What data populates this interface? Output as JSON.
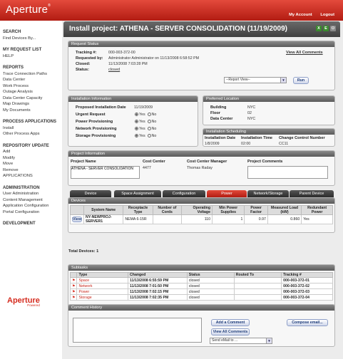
{
  "header": {
    "logo": "Aperture",
    "logo_mark": "®",
    "my_account": "My Account",
    "logout": "Logout"
  },
  "sidebar": {
    "groups": [
      {
        "heading": "SEARCH",
        "items": [
          "Find Devices By..."
        ]
      },
      {
        "heading": "MY REQUEST LIST",
        "items": [
          "HELP"
        ]
      },
      {
        "heading": "REPORTS",
        "items": [
          "Trace Connection Paths",
          "Data Center",
          "Work Process",
          "Outage Analysis",
          "Data Center Capacity",
          "Map Drawings",
          "My Documents"
        ]
      },
      {
        "heading": "PROCESS APPLICATIONS",
        "items": [
          "Install",
          "Other Process Apps"
        ]
      },
      {
        "heading": "REPOSITORY UPDATE",
        "items": [
          "Add",
          "Modify",
          "Move",
          "Remove",
          "APPLICATIONS"
        ]
      },
      {
        "heading": "ADMINISTRATION",
        "items": [
          "User Administration",
          "Content Management",
          "Application Configuration",
          "Portal Configuration"
        ]
      },
      {
        "heading": "DEVELOPMENT",
        "items": []
      }
    ],
    "bottom_logo": "Aperture",
    "bottom_logo_sub": "Powered"
  },
  "page": {
    "title": "Install project: ATHENA - SERVER CONSOLIDATION (11/19/2009)"
  },
  "request_status": {
    "heading": "Request Status",
    "tracking_label": "Tracking #:",
    "tracking": "000-003-372-00",
    "requested_label": "Requested by:",
    "requested": "Administrator Administrator on 11/13/2008 6:58:52 PM",
    "closed_label": "Closed:",
    "closed": "11/13/2008 7:03:28 PM",
    "status_label": "Status:",
    "status": "closed",
    "view_all": "View All Comments",
    "report_view": "--Report View--",
    "run": "Run"
  },
  "installation": {
    "heading": "Installation Information",
    "date_label": "Proposed Installation Date",
    "date": "11/19/2009",
    "rows": [
      {
        "label": "Urgent Request",
        "yes": "Yes",
        "no": "No"
      },
      {
        "label": "Power Provisioning",
        "yes": "Yes",
        "no": "No"
      },
      {
        "label": "Network Provisioning",
        "yes": "Yes",
        "no": "No"
      },
      {
        "label": "Storage Provisioning",
        "yes": "Yes",
        "no": "No"
      }
    ]
  },
  "location": {
    "heading": "Preferred Location",
    "building_label": "Building",
    "building": "NYC",
    "floor_label": "Floor",
    "floor": "02",
    "dc_label": "Data Center",
    "dc": "NYC"
  },
  "scheduling": {
    "heading": "Installation Scheduling",
    "col1": "Installation Date",
    "col2": "Installation Time",
    "col3": "Change Control Number",
    "v1": "1/8/2009",
    "v2": "02:00",
    "v3": "CC11"
  },
  "project": {
    "heading": "Project Information",
    "name_label": "Project Name",
    "name": "ATHENA - SERVER CONSOLIDATION",
    "cc_label": "Cost Center",
    "cc": "4477",
    "ccm_label": "Cost Center Manager",
    "ccm": "Thomas Raday",
    "comments_label": "Project Comments"
  },
  "tabs": [
    "Device",
    "Space Assignment",
    "Configuration",
    "Power",
    "Network/Storage",
    "Parent Device"
  ],
  "devices": {
    "heading": "Devices",
    "columns": [
      "",
      "System Name",
      "Receptacle Type",
      "Number of Cords",
      "Operating Voltage",
      "Min Power Supplies",
      "Power Factor",
      "Measured Load (kW)",
      "Redundant Power"
    ],
    "rows": [
      [
        "View",
        "NY-NEWPROJ-SERVER1",
        "NEMA 6-15R",
        "",
        "110",
        "1",
        "0.97",
        "0.860",
        "Yes"
      ]
    ],
    "total_label": "Total Devices:",
    "total": "1"
  },
  "subtasks": {
    "heading": "Subtasks",
    "columns": [
      "",
      "Type",
      "Changed",
      "Status",
      "Routed To",
      "Tracking #"
    ],
    "rows": [
      [
        "Space",
        "11/13/2008 6:55:59 PM",
        "closed",
        "",
        "000-003-372-01"
      ],
      [
        "Network",
        "11/13/2008 7:01:50 PM",
        "closed",
        "",
        "000-003-372-02"
      ],
      [
        "Power",
        "11/13/2008 7:02:15 PM",
        "closed",
        "",
        "000-003-372-03"
      ],
      [
        "Storage",
        "11/13/2008 7:02:35 PM",
        "closed",
        "",
        "000-003-372-04"
      ]
    ]
  },
  "comments": {
    "heading": "Comment History",
    "add": "Add a Comment",
    "view_all": "View All Comments",
    "send_email": "Send eMail to ...",
    "compose": "Compose email..."
  },
  "colors": {
    "brand": "#d52b1e",
    "header_dark": "#4a4a4a"
  }
}
